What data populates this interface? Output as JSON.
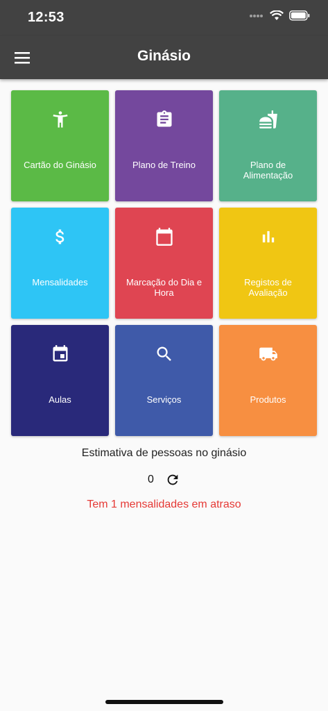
{
  "status": {
    "time": "12:53"
  },
  "appbar": {
    "title": "Ginásio"
  },
  "tiles": [
    {
      "label": "Cartão do Ginásio",
      "color": "#5bba46",
      "icon": "person-icon"
    },
    {
      "label": "Plano de Treino",
      "color": "#74489d",
      "icon": "clipboard-icon"
    },
    {
      "label": "Plano de Alimentação",
      "color": "#56b18a",
      "icon": "fastfood-icon"
    },
    {
      "label": "Mensalidades",
      "color": "#2ec5f5",
      "icon": "dollar-icon"
    },
    {
      "label": "Marcação do Dia e Hora",
      "color": "#df4552",
      "icon": "calendar-icon"
    },
    {
      "label": "Registos de Avaliação",
      "color": "#f0c613",
      "icon": "bar-chart-icon"
    },
    {
      "label": "Aulas",
      "color": "#29297a",
      "icon": "event-icon"
    },
    {
      "label": "Serviços",
      "color": "#3f5aa9",
      "icon": "search-icon"
    },
    {
      "label": "Produtos",
      "color": "#f78f41",
      "icon": "truck-icon"
    }
  ],
  "estimate": {
    "label": "Estimativa de pessoas no ginásio",
    "count": "0"
  },
  "warning": {
    "text": "Tem 1 mensalidades em atraso",
    "color": "#e53935"
  }
}
